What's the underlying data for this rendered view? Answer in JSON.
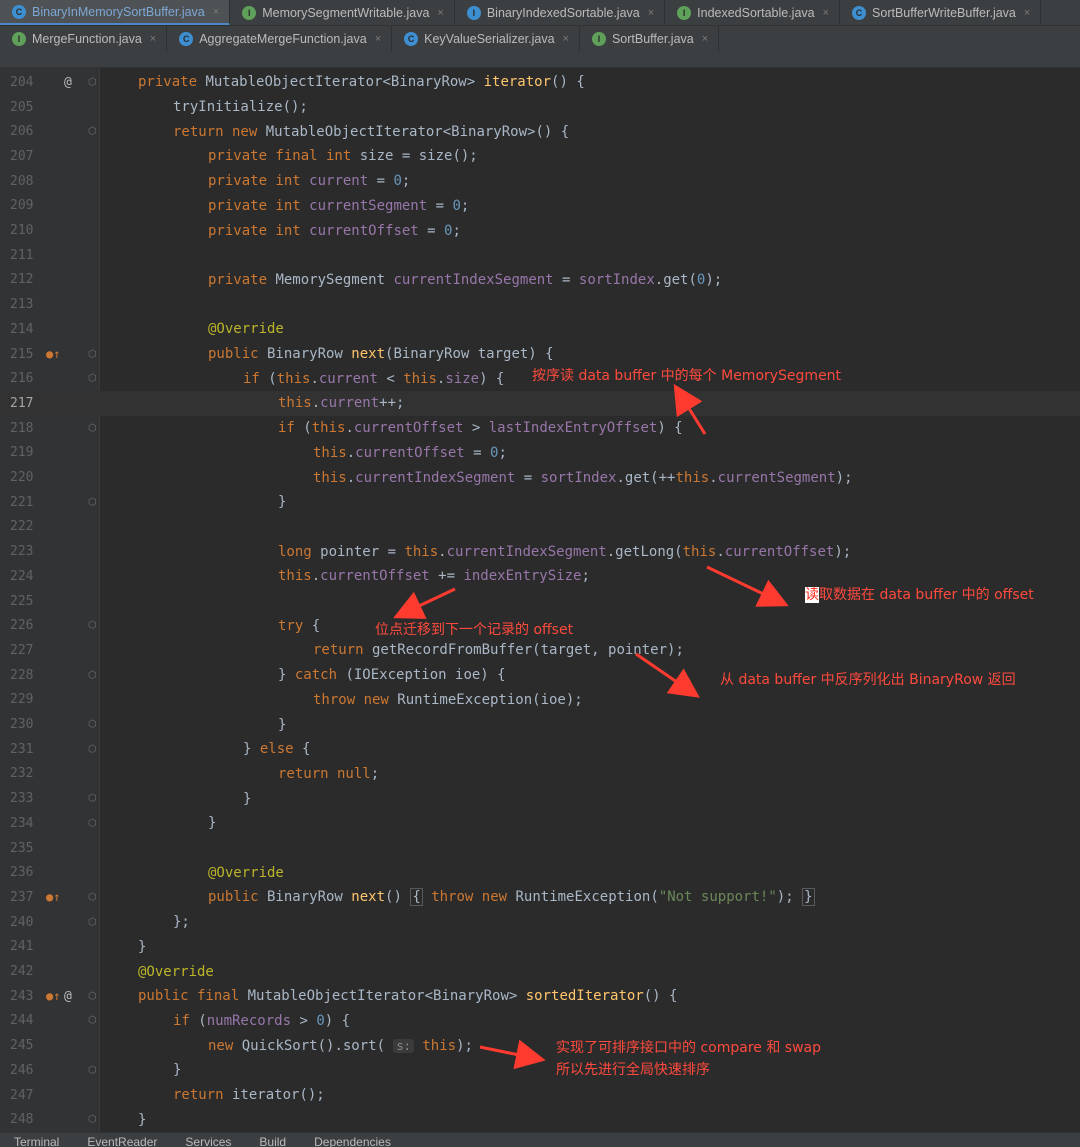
{
  "tabs_row1": [
    {
      "icon": "C",
      "kind": "c",
      "label": "BinaryInMemorySortBuffer.java",
      "active": true
    },
    {
      "icon": "I",
      "kind": "i",
      "label": "MemorySegmentWritable.java"
    },
    {
      "icon": "I",
      "kind": "a",
      "label": "BinaryIndexedSortable.java"
    },
    {
      "icon": "I",
      "kind": "i",
      "label": "IndexedSortable.java"
    },
    {
      "icon": "C",
      "kind": "c",
      "label": "SortBufferWriteBuffer.java"
    }
  ],
  "tabs_row2": [
    {
      "icon": "I",
      "kind": "i",
      "label": "MergeFunction.java"
    },
    {
      "icon": "C",
      "kind": "c",
      "label": "AggregateMergeFunction.java"
    },
    {
      "icon": "C",
      "kind": "c",
      "label": "KeyValueSerializer.java"
    },
    {
      "icon": "I",
      "kind": "i",
      "label": "SortBuffer.java"
    }
  ],
  "tab_close": "×",
  "lines": [
    {
      "n": "204",
      "mark": "@"
    },
    {
      "n": "205"
    },
    {
      "n": "206"
    },
    {
      "n": "207"
    },
    {
      "n": "208"
    },
    {
      "n": "209"
    },
    {
      "n": "210"
    },
    {
      "n": "211"
    },
    {
      "n": "212"
    },
    {
      "n": "213"
    },
    {
      "n": "214"
    },
    {
      "n": "215"
    },
    {
      "n": "216"
    },
    {
      "n": "217"
    },
    {
      "n": "218"
    },
    {
      "n": "219"
    },
    {
      "n": "220"
    },
    {
      "n": "221"
    },
    {
      "n": "222"
    },
    {
      "n": "223"
    },
    {
      "n": "224"
    },
    {
      "n": "225"
    },
    {
      "n": "226"
    },
    {
      "n": "227"
    },
    {
      "n": "228"
    },
    {
      "n": "229"
    },
    {
      "n": "230"
    },
    {
      "n": "231"
    },
    {
      "n": "232"
    },
    {
      "n": "233"
    },
    {
      "n": "234"
    },
    {
      "n": "235"
    },
    {
      "n": "236"
    },
    {
      "n": "237"
    },
    {
      "n": "240"
    },
    {
      "n": "241"
    },
    {
      "n": "242"
    },
    {
      "n": "243",
      "mark": "@"
    },
    {
      "n": "244"
    },
    {
      "n": "245"
    },
    {
      "n": "246"
    },
    {
      "n": "247"
    },
    {
      "n": "248"
    }
  ],
  "code": {
    "l204": [
      "private",
      " MutableObjectIterator<BinaryRow> ",
      "iterator",
      "() {"
    ],
    "l205": "tryInitialize();",
    "l206": [
      "return new",
      " MutableObjectIterator<BinaryRow>() {"
    ],
    "l207": [
      "private final int",
      " size = size();"
    ],
    "l208": [
      "private int",
      " ",
      "current",
      " = ",
      "0",
      ";"
    ],
    "l209": [
      "private int",
      " ",
      "currentSegment",
      " = ",
      "0",
      ";"
    ],
    "l210": [
      "private int",
      " ",
      "currentOffset",
      " = ",
      "0",
      ";"
    ],
    "l212": [
      "private",
      " MemorySegment ",
      "currentIndexSegment",
      " = ",
      "sortIndex",
      ".get(",
      "0",
      ");"
    ],
    "l214": "@Override",
    "l215": [
      "public",
      " BinaryRow ",
      "next",
      "(BinaryRow target) {"
    ],
    "l216": [
      "if",
      " (",
      "this",
      ".",
      "current",
      " < ",
      "this",
      ".",
      "size",
      ") {"
    ],
    "l217": [
      "this",
      ".",
      "current",
      "++;"
    ],
    "l218": [
      "if",
      " (",
      "this",
      ".",
      "currentOffset",
      " > ",
      "lastIndexEntryOffset",
      ") {"
    ],
    "l219": [
      "this",
      ".",
      "currentOffset",
      " = ",
      "0",
      ";"
    ],
    "l220": [
      "this",
      ".",
      "currentIndexSegment",
      " = ",
      "sortIndex",
      ".get(++",
      "this",
      ".",
      "currentSegment",
      ");"
    ],
    "l221": "}",
    "l223": [
      "long",
      " pointer = ",
      "this",
      ".",
      "currentIndexSegment",
      ".getLong(",
      "this",
      ".",
      "currentOffset",
      ");"
    ],
    "l224": [
      "this",
      ".",
      "currentOffset",
      " += ",
      "indexEntrySize",
      ";"
    ],
    "l226": [
      "try",
      " {"
    ],
    "l227": [
      "return",
      " getRecordFromBuffer(target, pointer);"
    ],
    "l228": [
      "} ",
      "catch",
      " (IOException ioe) {"
    ],
    "l229": [
      "throw new",
      " RuntimeException(ioe);"
    ],
    "l230": "}",
    "l231": [
      "} ",
      "else",
      " {"
    ],
    "l232": [
      "return null",
      ";"
    ],
    "l233": "}",
    "l234": "}",
    "l236": "@Override",
    "l237": [
      "public",
      " BinaryRow ",
      "next",
      "() ",
      "{",
      " ",
      "throw new",
      " RuntimeException(",
      "\"Not support!\"",
      "); ",
      "}"
    ],
    "l240": "};",
    "l241": "}",
    "l242": "@Override",
    "l243": [
      "public final",
      " MutableObjectIterator<BinaryRow> ",
      "sortedIterator",
      "() {"
    ],
    "l244": [
      "if",
      " (",
      "numRecords",
      " > ",
      "0",
      ") {"
    ],
    "l245": [
      "new",
      " QuickSort().sort( ",
      "s:",
      " ",
      "this",
      ");"
    ],
    "l246": "}",
    "l247": [
      "return",
      " iterator();"
    ],
    "l248": "}"
  },
  "notes": {
    "n1": "按序读 data buffer 中的每个 MemorySegment",
    "n2_hl": "读",
    "n2_rest": "取数据在 data buffer 中的 offset",
    "n3": "位点迁移到下一个记录的 offset",
    "n4": "从 data buffer 中反序列化出 BinaryRow 返回",
    "n5a": "实现了可排序接口中的 compare 和 swap",
    "n5b": "所以先进行全局快速排序"
  },
  "bottom": [
    "Terminal",
    "EventReader",
    "Services",
    "Build",
    "Dependencies"
  ],
  "colors": {
    "keyword": "#cc7832",
    "field": "#9876aa",
    "method": "#ffc66d",
    "number": "#6897bb",
    "annotation": "#bbb529",
    "note": "#ff4a3d"
  }
}
